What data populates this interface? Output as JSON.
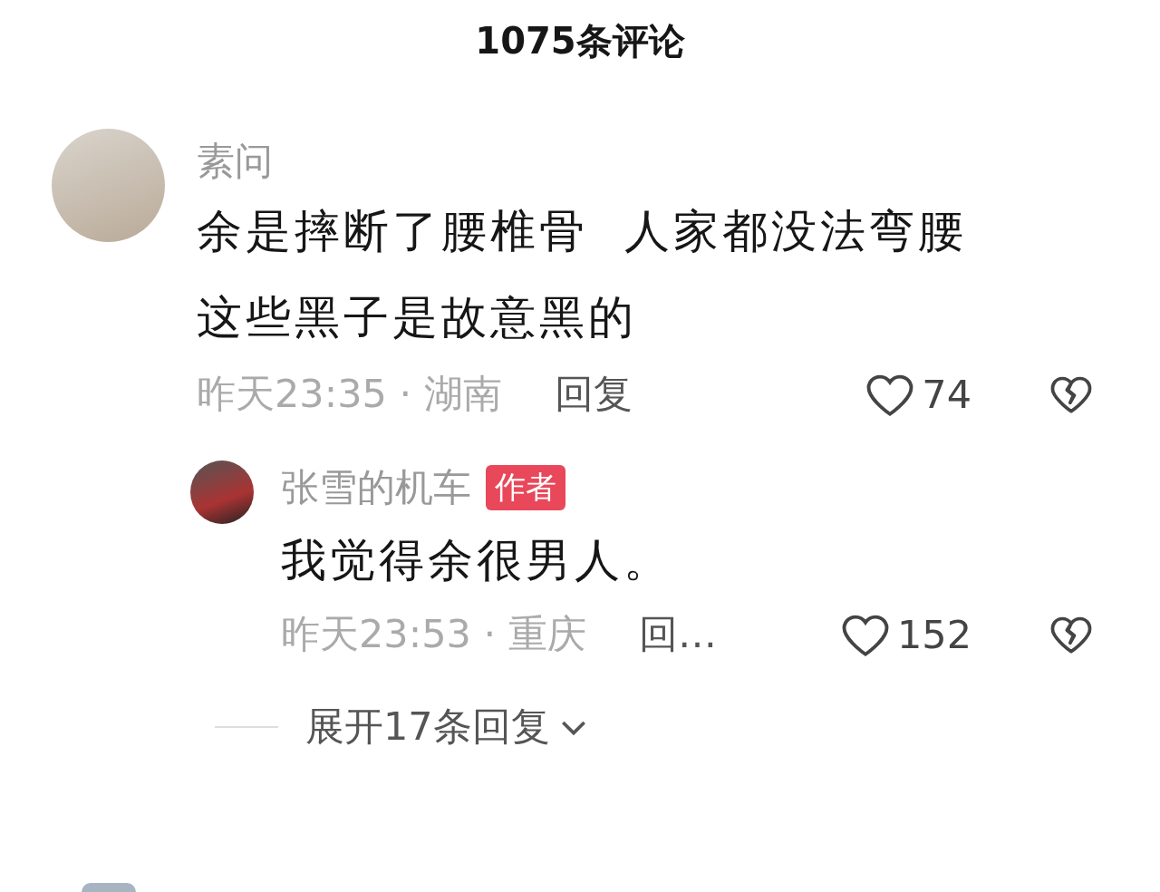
{
  "title": "1075条评论",
  "comments": [
    {
      "user": "素问",
      "text": "余是摔断了腰椎骨  人家都没法弯腰这些黑子是故意黑的",
      "time_location": "昨天23:35 · 湖南",
      "reply_label": "回复",
      "likes": "74",
      "replies": [
        {
          "user": "张雪的机车",
          "badge": "作者",
          "text": "我觉得余很男人。",
          "time_location": "昨天23:53 · 重庆",
          "reply_label": "回…",
          "likes": "152"
        }
      ],
      "expand_label": "展开17条回复"
    }
  ]
}
